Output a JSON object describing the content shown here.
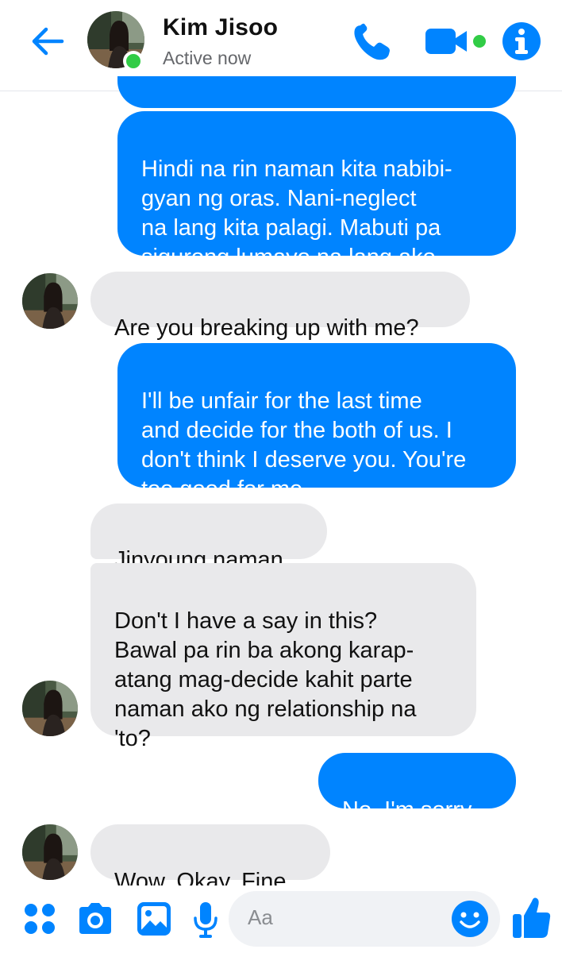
{
  "header": {
    "contact_name": "Kim Jisoo",
    "status": "Active now",
    "icons": [
      "back-arrow-icon",
      "phone-icon",
      "video-camera-icon",
      "info-icon"
    ],
    "accent_color": "#0084ff",
    "online_color": "#31cc46"
  },
  "messages": [
    {
      "from": "me",
      "text": ""
    },
    {
      "from": "me",
      "text": "Hindi na rin naman kita nabibi-\ngyan ng oras. Nani-neglect\nna lang kita palagi. Mabuti pa\nsigurong lumayo na lang ako."
    },
    {
      "from": "contact",
      "text": "Are you breaking up with me?"
    },
    {
      "from": "me",
      "text": "I'll be unfair for the last time\nand decide for the both of us. I\ndon't think I deserve you. You're\ntoo good for me."
    },
    {
      "from": "contact",
      "text": "Jinyoung naman"
    },
    {
      "from": "contact",
      "text": "Don't I have a say in this?\nBawal pa rin ba akong karap-\natang mag-decide kahit parte\nnaman ako ng relationship na\n'to?"
    },
    {
      "from": "me",
      "text": "No. I'm sorry."
    },
    {
      "from": "contact",
      "text": "Wow. Okay. Fine."
    }
  ],
  "composer": {
    "placeholder": "Aa",
    "icons": [
      "apps-grid-icon",
      "camera-icon",
      "gallery-icon",
      "microphone-icon",
      "emoji-icon",
      "thumbs-up-icon"
    ]
  }
}
